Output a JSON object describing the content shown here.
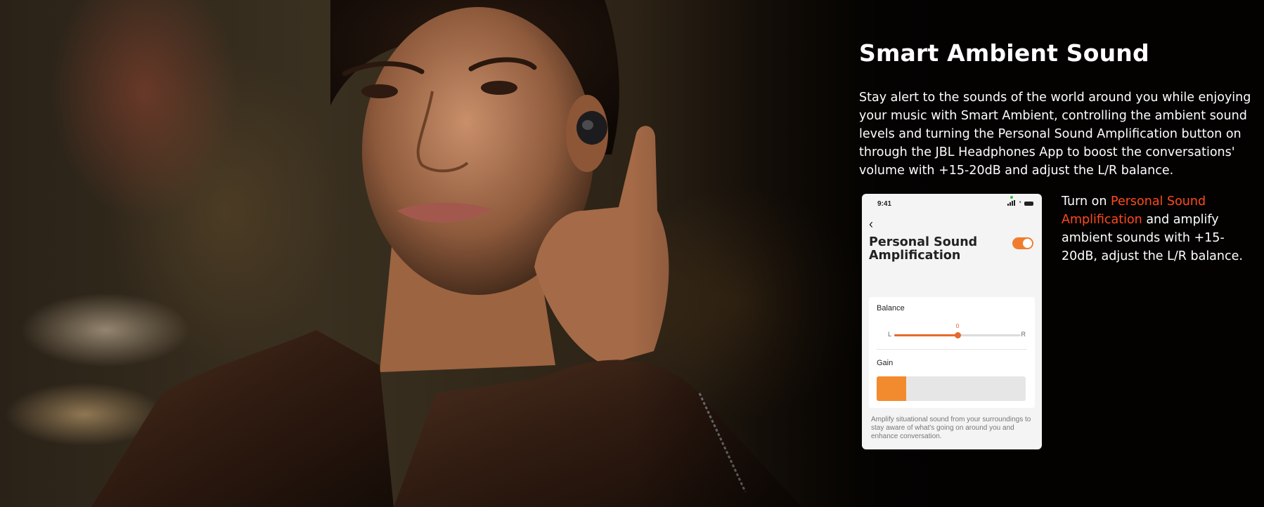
{
  "hero": {
    "photo_icon": "woman-wearing-earbuds-photo"
  },
  "section": {
    "title": "Smart Ambient Sound",
    "intro": "Stay alert to the sounds of the world around you while enjoying your music with Smart Ambient, controlling the ambient sound levels and turning the Personal Sound Amplification button on through the JBL Headphones App to boost the conversations' volume with +15-20dB and adjust the L/R balance."
  },
  "callout": {
    "prefix": "Turn on ",
    "highlight": "Personal Sound Amplification",
    "suffix": " and amplify ambient sounds with +15-20dB, adjust the L/R balance.",
    "highlight_color": "#ff4a1e"
  },
  "phone": {
    "time": "9:41",
    "back_icon": "chevron-left-icon",
    "title": "Personal Sound Amplification",
    "toggle_on": true,
    "balance": {
      "label": "Balance",
      "value": "0",
      "left_label": "L",
      "right_label": "R",
      "level": 0.5
    },
    "gain": {
      "label": "Gain",
      "level": 0.2
    },
    "description": "Amplify situational sound from your surroundings to stay aware of what's going on around you and enhance conversation.",
    "accent_color": "#f07d2d"
  }
}
